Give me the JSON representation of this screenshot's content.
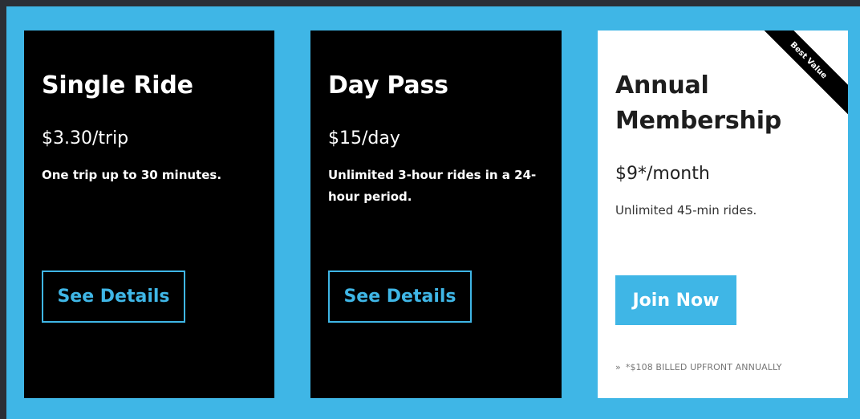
{
  "plans": [
    {
      "title": "Single Ride",
      "price": "$3.30/trip",
      "description": "One trip up to 30 minutes.",
      "button": "See Details"
    },
    {
      "title": "Day Pass",
      "price": "$15/day",
      "description": "Unlimited 3-hour rides in a 24-hour period.",
      "button": "See Details"
    },
    {
      "title": "Annual Membership",
      "price": "$9*/month",
      "description": "Unlimited 45-min rides.",
      "button": "Join Now",
      "badge": "Best Value",
      "footnote": "*$108 BILLED UPFRONT ANNUALLY",
      "footnote_marker": "»"
    }
  ],
  "colors": {
    "accent": "#3fb6e6",
    "dark_card": "#000000",
    "light_card": "#ffffff",
    "outer_frame": "#2b2f36"
  },
  "icons": {
    "footnote_arrow": "double-chevron-right-icon"
  }
}
